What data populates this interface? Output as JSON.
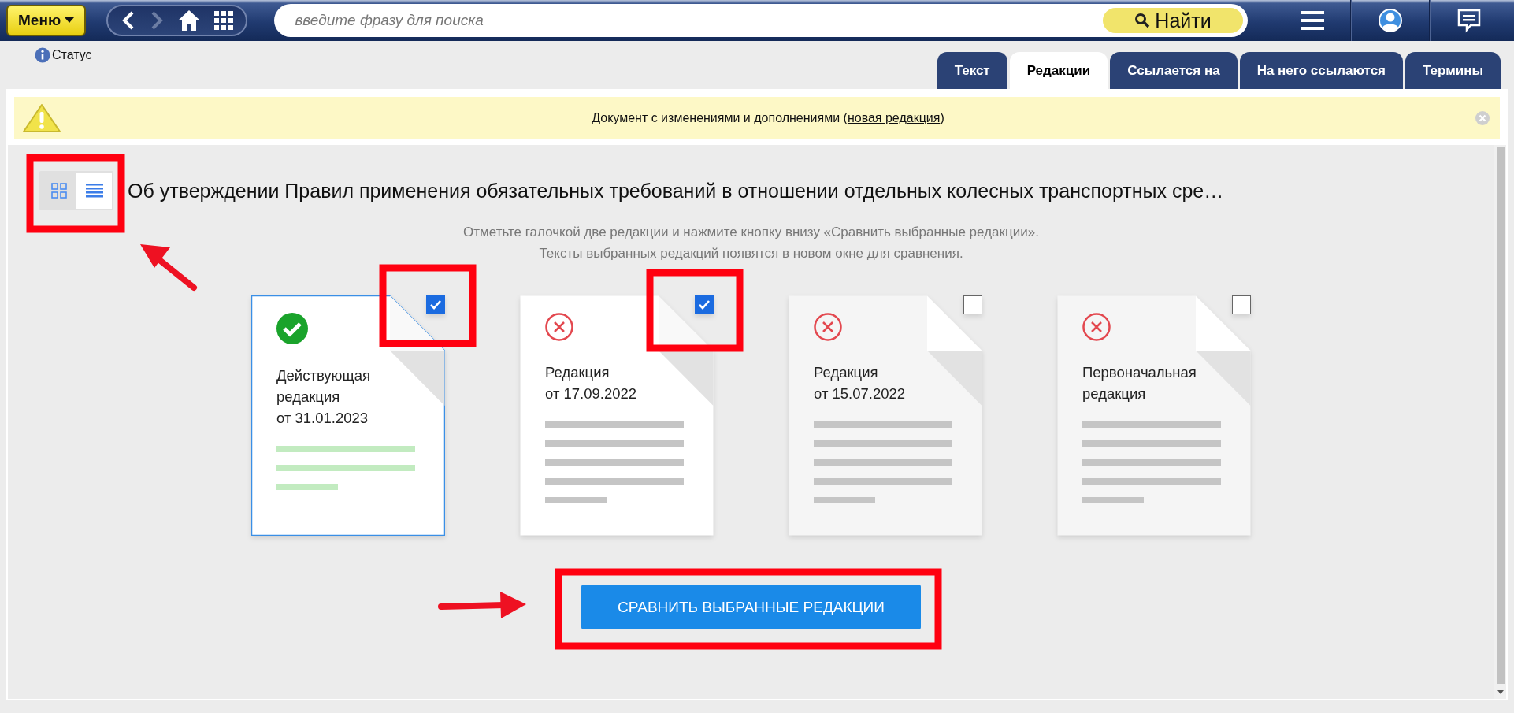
{
  "top_bar": {
    "menu_button": "Меню",
    "search": {
      "placeholder": "введите фразу для поиска"
    },
    "search_button": "Найти"
  },
  "status_link": "Статус",
  "tabs": [
    {
      "label": "Текст",
      "selected": false
    },
    {
      "label": "Редакции",
      "selected": true
    },
    {
      "label": "Ссылается на",
      "selected": false
    },
    {
      "label": "На него ссылаются",
      "selected": false
    },
    {
      "label": "Термины",
      "selected": false
    }
  ],
  "notice": {
    "text_before": "Документ с изменениями и дополнениями (",
    "link": "новая редакция",
    "text_after": ")"
  },
  "document": {
    "title": "Об утверждении Правил применения обязательных требований в отношении отдельных колесных транспортных сре…",
    "view_modes": [
      {
        "kind": "grid",
        "selected": false
      },
      {
        "kind": "list",
        "selected": true
      }
    ],
    "instructions": [
      "Отметьте галочкой две редакции и нажмите кнопку внизу «Сравнить выбранные редакции».",
      "Тексты выбранных редакций появятся в новом окне для сравнения."
    ]
  },
  "revisions": [
    {
      "kind": "current",
      "title": "Действующая\nредакция\nот 31.01.2023",
      "checked": true
    },
    {
      "kind": "outdated",
      "title": "Редакция\nот 17.09.2022",
      "checked": true
    },
    {
      "kind": "outdated",
      "title": "Редакция\nот 15.07.2022",
      "checked": false
    },
    {
      "kind": "outdated",
      "title": "Первоначальная\nредакция",
      "checked": false
    }
  ],
  "compare_button": "СРАВНИТЬ ВЫБРАННЫЕ РЕДАКЦИИ"
}
